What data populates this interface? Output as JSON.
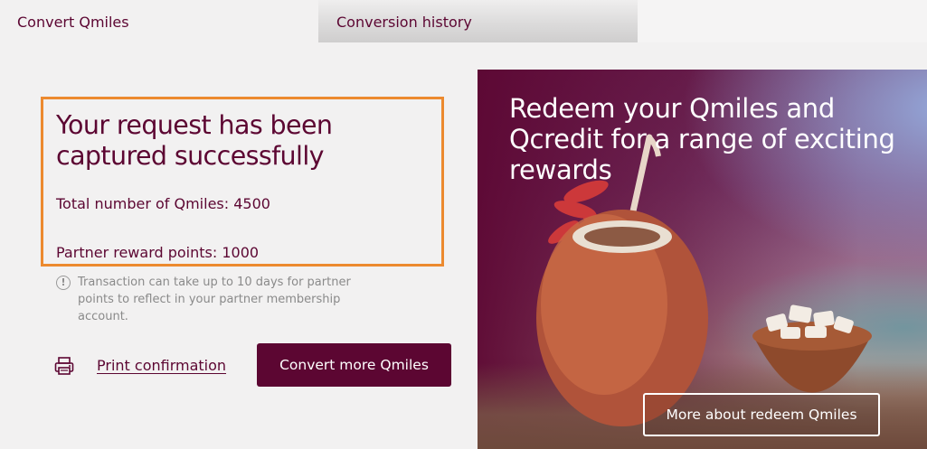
{
  "tabs": [
    {
      "label": "Convert Qmiles",
      "active": true
    },
    {
      "label": "Conversion history",
      "active": false
    }
  ],
  "success": {
    "title": "Your request has been captured successfully",
    "total_qmiles": "Total number of Qmiles: 4500",
    "partner_points": "Partner reward points: 1000"
  },
  "note": {
    "icon": "info-icon",
    "text": "Transaction can take up to 10 days for partner points to reflect in your partner membership account."
  },
  "actions": {
    "print_icon": "printer-icon",
    "print_label": "Print confirmation",
    "convert_label": "Convert more Qmiles"
  },
  "promo": {
    "title": "Redeem your Qmiles and Qcredit for a range of exciting rewards",
    "button_label": "More about redeem Qmiles"
  },
  "colors": {
    "brand": "#5c0632",
    "highlight_border": "#ec8a2f",
    "background": "#f2f1f1",
    "note_text": "#8a8a8a"
  }
}
